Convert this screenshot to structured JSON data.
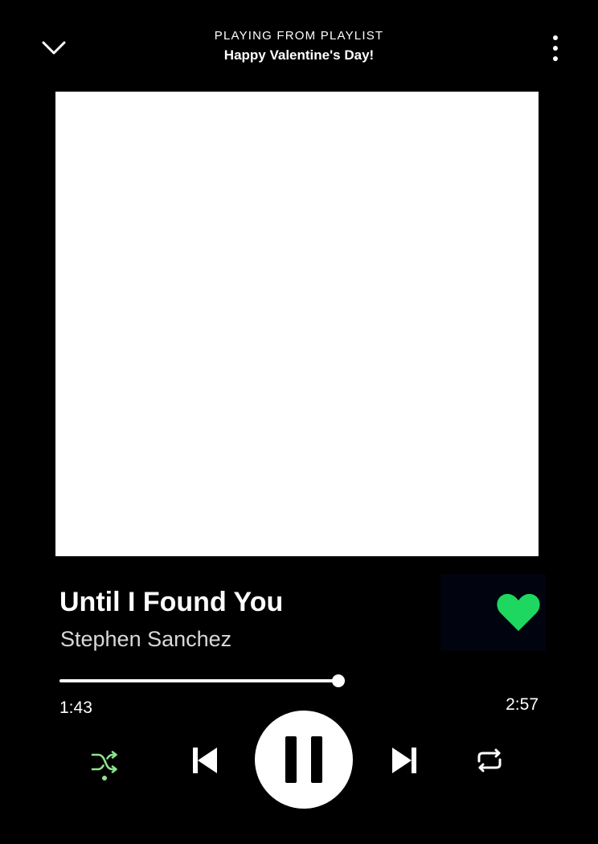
{
  "header": {
    "context_label": "PLAYING FROM PLAYLIST",
    "playlist_name": "Happy Valentine's Day!",
    "collapse_icon": "chevron-down-icon",
    "menu_icon": "more-vertical-icon"
  },
  "track": {
    "title": "Until I Found You",
    "artist": "Stephen Sanchez",
    "liked": true,
    "like_icon": "heart-icon",
    "like_color": "#1ed760"
  },
  "playback": {
    "elapsed": "1:43",
    "duration": "2:57",
    "progress_fraction": 0.582,
    "is_playing": true,
    "shuffle_enabled": true,
    "shuffle_color": "#8fe38f",
    "repeat_enabled": false
  },
  "controls": {
    "shuffle_icon": "shuffle-icon",
    "previous_icon": "skip-previous-icon",
    "play_pause_icon": "pause-icon",
    "next_icon": "skip-next-icon",
    "repeat_icon": "repeat-icon"
  },
  "colors": {
    "background": "#000000",
    "text_primary": "#ffffff",
    "text_secondary": "#d8d8d8"
  }
}
